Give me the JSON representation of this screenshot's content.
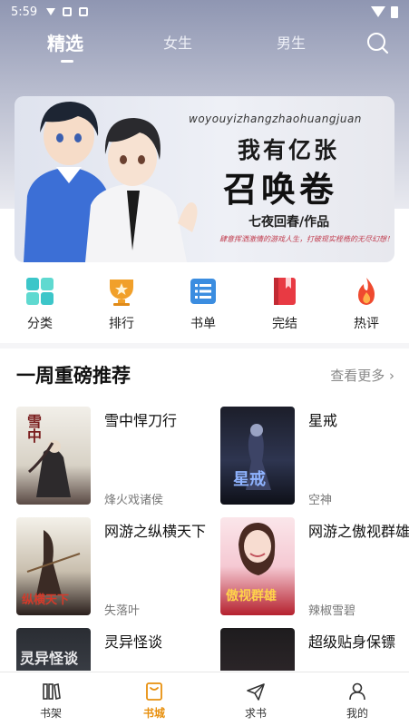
{
  "status_bar": {
    "time": "5:59"
  },
  "top_tabs": [
    {
      "label": "精选",
      "active": true
    },
    {
      "label": "女生",
      "active": false
    },
    {
      "label": "男生",
      "active": false
    }
  ],
  "banner": {
    "pinyin": "woyouyizhangzhaohuangjuan",
    "title_line1": "我有亿张",
    "title_line2": "召唤卷",
    "author": "七夜回春/作品",
    "tagline": "肆意挥洒激情的游戏人生，打破现实桎梏的无尽幻想！"
  },
  "quick_nav": [
    {
      "label": "分类",
      "icon": "category-icon",
      "color": "#3cc6c9"
    },
    {
      "label": "排行",
      "icon": "trophy-icon",
      "color": "#f1a02a"
    },
    {
      "label": "书单",
      "icon": "booklist-icon",
      "color": "#3b8de0"
    },
    {
      "label": "完结",
      "icon": "completed-book-icon",
      "color": "#e83a43"
    },
    {
      "label": "热评",
      "icon": "flame-icon",
      "color": "#ef4a2f"
    }
  ],
  "section": {
    "title": "一周重磅推荐",
    "more": "查看更多 ›"
  },
  "books": [
    {
      "title": "雪中悍刀行",
      "author": "烽火戏诸侯",
      "cover_text": "雪中"
    },
    {
      "title": "星戒",
      "author": "空神",
      "cover_text": "星戒"
    },
    {
      "title": "网游之纵横天下",
      "author": "失落叶",
      "cover_text": "纵横天下"
    },
    {
      "title": "网游之傲视群雄",
      "author": "辣椒雪碧",
      "cover_text": "傲视群雄"
    },
    {
      "title": "灵异怪谈",
      "author": "",
      "cover_text": "灵异怪谈"
    },
    {
      "title": "超级贴身保镖",
      "author": "",
      "cover_text": ""
    }
  ],
  "bottom_nav": [
    {
      "label": "书架",
      "icon": "bookshelf-icon",
      "active": false
    },
    {
      "label": "书城",
      "icon": "bookstore-icon",
      "active": true
    },
    {
      "label": "求书",
      "icon": "paper-plane-icon",
      "active": false
    },
    {
      "label": "我的",
      "icon": "profile-icon",
      "active": false
    }
  ],
  "colors": {
    "accent": "#e8900e"
  }
}
